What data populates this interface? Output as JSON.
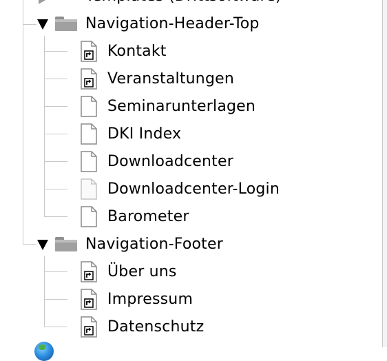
{
  "tree": {
    "top_partial_item": {
      "label": "Templates (Drittsoftware)"
    },
    "folders": [
      {
        "label": "Navigation-Header-Top",
        "expanded": true,
        "icon": "folder-icon",
        "items": [
          {
            "label": "Kontakt",
            "icon": "page-shortcut-icon"
          },
          {
            "label": "Veranstaltungen",
            "icon": "page-shortcut-icon"
          },
          {
            "label": "Seminarunterlagen",
            "icon": "page-icon"
          },
          {
            "label": "DKI Index",
            "icon": "page-icon"
          },
          {
            "label": "Downloadcenter",
            "icon": "page-icon"
          },
          {
            "label": "Downloadcenter-Login",
            "icon": "page-hidden-icon"
          },
          {
            "label": "Barometer",
            "icon": "page-icon"
          }
        ]
      },
      {
        "label": "Navigation-Footer",
        "expanded": true,
        "icon": "folder-icon",
        "items": [
          {
            "label": "Über uns",
            "icon": "page-shortcut-icon"
          },
          {
            "label": "Impressum",
            "icon": "page-shortcut-icon"
          },
          {
            "label": "Datenschutz",
            "icon": "page-shortcut-icon"
          }
        ]
      }
    ],
    "bottom_partial_item": {
      "icon": "globe-icon"
    }
  },
  "colors": {
    "connector": "#c8c8c8",
    "folder": "#a0a0a0",
    "page_outline": "#8a8a8a",
    "page_hidden_outline": "#c4c4c4"
  }
}
